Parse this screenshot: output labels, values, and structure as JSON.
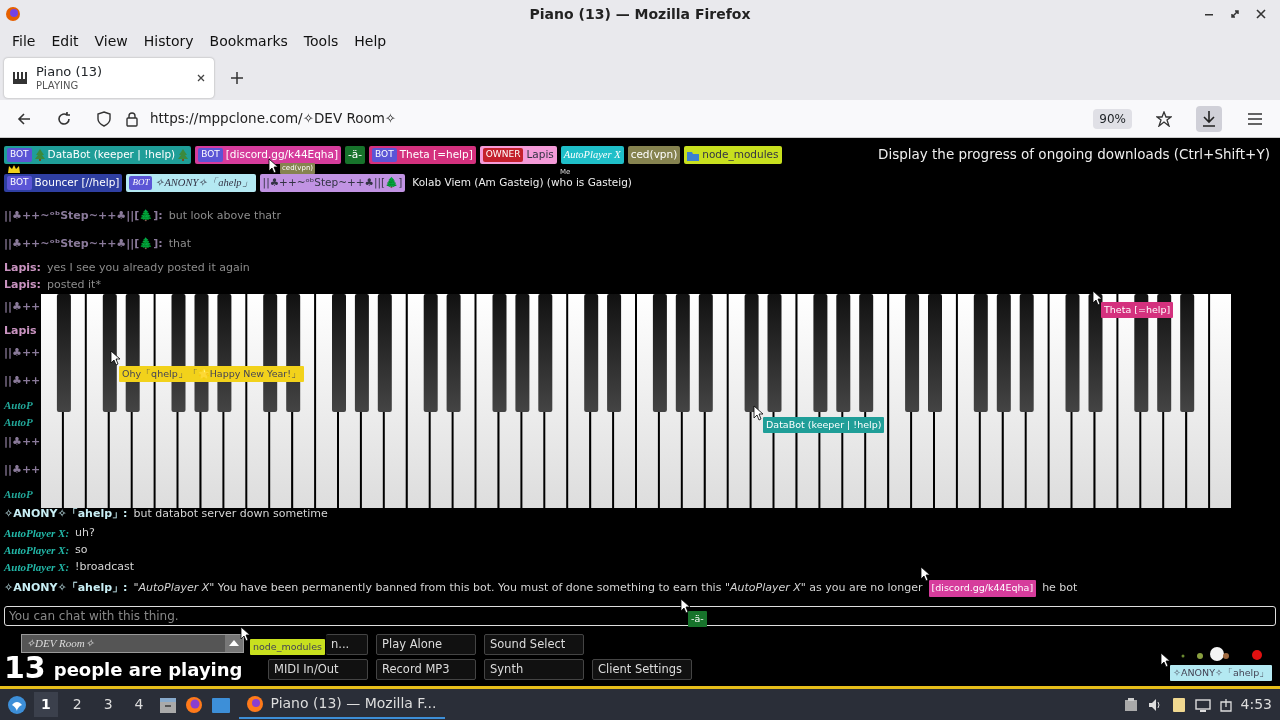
{
  "window": {
    "title": "Piano (13) — Mozilla Firefox"
  },
  "menu": [
    "File",
    "Edit",
    "View",
    "History",
    "Bookmarks",
    "Tools",
    "Help"
  ],
  "tabs": [
    {
      "title": "Piano (13)",
      "subtitle": "PLAYING",
      "selected": true
    }
  ],
  "address_bar": {
    "url": "https://mppclone.com/✧DEV Room✧",
    "zoom": "90%"
  },
  "tooltip": "Display the progress of ongoing downloads (Ctrl+Shift+Y)",
  "players": [
    [
      {
        "kind": "tree",
        "badge": {
          "label": "BOT",
          "color": "#5b55d6"
        },
        "name": "DataBot (keeper | !help)",
        "color": "#1f9e98"
      },
      {
        "kind": "plain",
        "badge": {
          "label": "BOT",
          "color": "#5b55d6"
        },
        "name": "[discord.gg/k44Eqha]",
        "color": "#d63c9c"
      },
      {
        "kind": "plain",
        "name": "-ä-",
        "color": "#17732b"
      },
      {
        "kind": "plain",
        "badge": {
          "label": "BOT",
          "color": "#5b55d6"
        },
        "name": "Theta [=help]",
        "color": "#d4317e"
      },
      {
        "kind": "plain",
        "badge": {
          "label": "OWNER",
          "color": "#c4202c"
        },
        "name": "Lapis",
        "color": "#f49ad8"
      },
      {
        "kind": "plain",
        "name": "AutoPlayer X",
        "color": "#1fbfc9",
        "fancy": true
      },
      {
        "kind": "plain",
        "name": "ced(vpn)",
        "color": "#868350"
      },
      {
        "kind": "folder",
        "name": "node_modules",
        "color": "#c8e01e"
      }
    ],
    [
      {
        "kind": "plain",
        "badge": {
          "label": "BOT",
          "color": "#5b55d6"
        },
        "name": "Bouncer [//help]",
        "color": "#2f3fa2",
        "crown": true
      },
      {
        "kind": "plain",
        "badge": {
          "label": "BOT",
          "color": "#5b55d6"
        },
        "name": "✧ANONY✧「ahelp」",
        "color": "#b4e9f2",
        "fancy": true
      },
      {
        "kind": "plain",
        "name": "||♣++~ᵒᵇStep~++♣||[🌲]",
        "color": "#c193e3"
      },
      {
        "kind": "plain",
        "name": "Kolab Viem (Am Gasteig) (who is Gasteig)"
      }
    ]
  ],
  "chat": {
    "messages": [
      {
        "kind": "full",
        "name": "||♣++~ᵒᵇStep~++♣||[🌲]:",
        "text": "but look above thatr",
        "color": "#8a7a9a",
        "faded": true
      },
      {
        "kind": "full",
        "name": "||♣++~ᵒᵇStep~++♣||[🌲]:",
        "text": "that",
        "color": "#8a7a9a",
        "faded": true
      },
      {
        "kind": "full",
        "name": "Lapis:",
        "text": "yes I see you already posted it again",
        "color": "#c993c0",
        "faded": true
      },
      {
        "kind": "full",
        "name": "Lapis:",
        "text": "posted it*",
        "color": "#c993c0",
        "faded": true
      },
      {
        "kind": "cut",
        "name": "||♣++",
        "color": "#8a7a9a"
      },
      {
        "kind": "cut",
        "name": "Lapis",
        "color": "#c993c0"
      },
      {
        "kind": "cut",
        "name": "||♣++",
        "color": "#8a7a9a"
      },
      {
        "kind": "cut",
        "name": "||♣++",
        "color": "#8a7a9a"
      },
      {
        "kind": "cut",
        "name": "AutoP",
        "color": "#22a89a",
        "fancy": true
      },
      {
        "kind": "cut",
        "name": "AutoP",
        "color": "#22a89a",
        "fancy": true
      },
      {
        "kind": "cut",
        "name": "||♣++",
        "color": "#8a7a9a"
      },
      {
        "kind": "cut",
        "name": "||♣++",
        "color": "#8a7a9a"
      },
      {
        "kind": "cut",
        "name": "AutoP",
        "color": "#22a89a",
        "fancy": true
      },
      {
        "kind": "full",
        "name": "✧ANONY✧「ahelp」:",
        "text": "but databot server down sometime",
        "color": "#c8eef4",
        "faded": false
      },
      {
        "kind": "full",
        "name": "AutoPlayer X:",
        "text": "uh?",
        "color": "#22b8a8",
        "faded": false,
        "fancy": true
      },
      {
        "kind": "full",
        "name": "AutoPlayer X:",
        "text": "so",
        "color": "#22b8a8",
        "faded": false,
        "fancy": true
      },
      {
        "kind": "full",
        "name": "AutoPlayer X:",
        "text": "!broadcast",
        "color": "#22b8a8",
        "faded": false,
        "fancy": true
      },
      {
        "kind": "full",
        "name": "✧ANONY✧「ahelp」:",
        "text": "\"*AutoPlayer X*\" You have been permanently banned from this bot. You must of done something to earn this \"*AutoPlayer X*\" as you are no longer",
        "tail": "he bot",
        "color": "#c8eef4",
        "faded": false
      }
    ],
    "placeholder": "You can chat with this thing."
  },
  "cursors": [
    {
      "label": "Ohy「qhelp」「🌟Happy New Year!」",
      "color": "#f2d21b"
    },
    {
      "label": "DataBot (keeper | !help)",
      "color": "#1f9e98"
    },
    {
      "label": "Theta [=help]",
      "color": "#d4317e"
    },
    {
      "label": "[discord.gg/k44Eqha]",
      "color": "#d63c9c"
    },
    {
      "label": "-ä-",
      "color": "#17732b"
    },
    {
      "label": "node_modules",
      "color": "#c8e01e"
    },
    {
      "label": "✧ANONY✧「ahelp」",
      "color": "#b4e9f2"
    },
    {
      "label": "ced(vpn)",
      "color": "#868350"
    },
    {
      "label": "Me"
    }
  ],
  "room": {
    "name": "✧DEV Room✧",
    "count": "13",
    "count_text": "people are playing"
  },
  "buttons": [
    [
      "n...",
      "Play Alone",
      "Sound Select"
    ],
    [
      "MIDI In/Out",
      "Record MP3",
      "Synth",
      "Client Settings"
    ]
  ],
  "taskbar": {
    "workspaces": [
      {
        "label": "1",
        "selected": true
      },
      {
        "label": "2",
        "selected": false
      },
      {
        "label": "3",
        "selected": false
      },
      {
        "label": "4",
        "selected": false
      }
    ],
    "task": "Piano (13) — Mozilla F...",
    "clock": "4:53"
  }
}
